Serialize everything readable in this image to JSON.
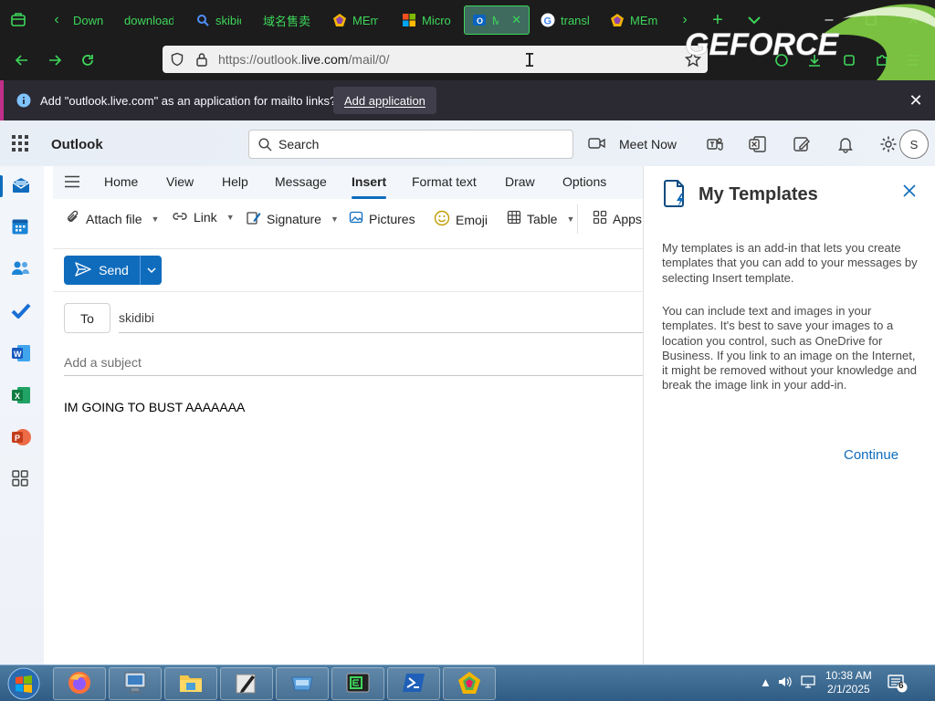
{
  "browser": {
    "tabs": [
      {
        "label": "Down",
        "favicon": "green-arrow-icon"
      },
      {
        "label": "download",
        "favicon": "none"
      },
      {
        "label": "skibid",
        "favicon": "search-icon"
      },
      {
        "label": "域名售卖",
        "favicon": "none"
      },
      {
        "label": "MEm",
        "favicon": "memu-icon"
      },
      {
        "label": "Micro",
        "favicon": "microsoft-icon"
      },
      {
        "label": "M",
        "favicon": "outlook-icon"
      },
      {
        "label": "transl",
        "favicon": "google-icon"
      },
      {
        "label": "MEm",
        "favicon": "memu-icon"
      }
    ],
    "url_prefix": "https://outlook.",
    "url_domain": "live.com",
    "url_suffix": "/mail/0/",
    "overlay_text": "GEFORCE",
    "accent_color": "#3dd65a"
  },
  "notification": {
    "text": "Add \"outlook.live.com\" as an application for mailto links?",
    "button": "Add application"
  },
  "outlook": {
    "brand": "Outlook",
    "search_label": "Search",
    "meet_now": "Meet Now",
    "avatar_initial": "S",
    "ribbon_tabs": [
      "Home",
      "View",
      "Help",
      "Message",
      "Insert",
      "Format text",
      "Draw",
      "Options"
    ],
    "active_tab": "Insert",
    "commands": {
      "attach": "Attach file",
      "link": "Link",
      "signature": "Signature",
      "pictures": "Pictures",
      "emoji": "Emoji",
      "table": "Table",
      "apps": "Apps"
    },
    "compose": {
      "send": "Send",
      "to_label": "To",
      "recipient": "skidibi",
      "subject_placeholder": "Add a subject",
      "body": "IM GOING TO BUST AAAAAAA"
    },
    "accent_color": "#0f6cbd"
  },
  "addin_pane": {
    "title": "My Templates",
    "paragraph1": "My templates is an add-in that lets you create templates that you can add to your messages by selecting Insert template.",
    "paragraph2": "You can include text and images in your templates. It's best to save your images to a location you control, such as OneDrive for Business. If you link to an image on the Internet, it might be removed without your knowledge and break the image link in your add-in.",
    "continue": "Continue"
  },
  "taskbar": {
    "time": "10:38 AM",
    "date": "2/1/2025",
    "notification_count": "6"
  }
}
